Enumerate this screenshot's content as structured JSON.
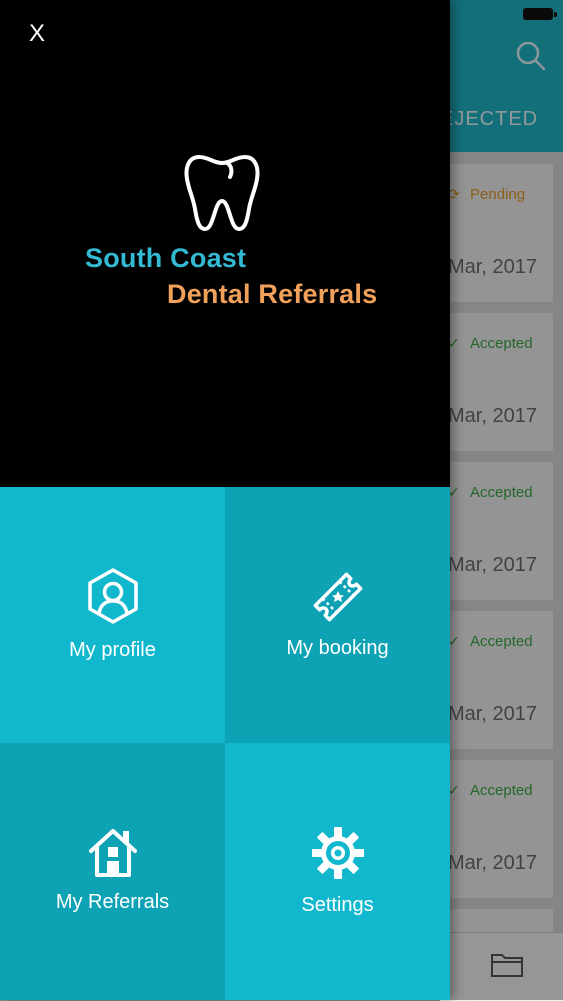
{
  "background": {
    "tab_label": "EJECTED",
    "cards": [
      {
        "status": "Pending",
        "status_color": "#e39b2a",
        "date": "Mar, 2017"
      },
      {
        "status": "Accepted",
        "status_color": "#3aa845",
        "date": "Mar, 2017"
      },
      {
        "status": "Accepted",
        "status_color": "#3aa845",
        "date": "Mar, 2017"
      },
      {
        "status": "Accepted",
        "status_color": "#3aa845",
        "date": "Mar, 2017"
      },
      {
        "status": "Accepted",
        "status_color": "#3aa845",
        "date": "Mar, 2017"
      }
    ]
  },
  "drawer": {
    "close_label": "X",
    "brand": {
      "line1": "South Coast",
      "line2": "Dental Referrals",
      "icon": "tooth-icon"
    },
    "menu": [
      {
        "label": "My profile",
        "icon": "profile-icon"
      },
      {
        "label": "My booking",
        "icon": "ticket-icon"
      },
      {
        "label": "My Referrals",
        "icon": "house-icon"
      },
      {
        "label": "Settings",
        "icon": "gear-icon"
      }
    ]
  },
  "colors": {
    "accent_teal": "#11b8cd",
    "accent_dark_teal": "#0ea2b5",
    "brand_blue": "#33b9d1",
    "brand_orange": "#f2a15a"
  }
}
